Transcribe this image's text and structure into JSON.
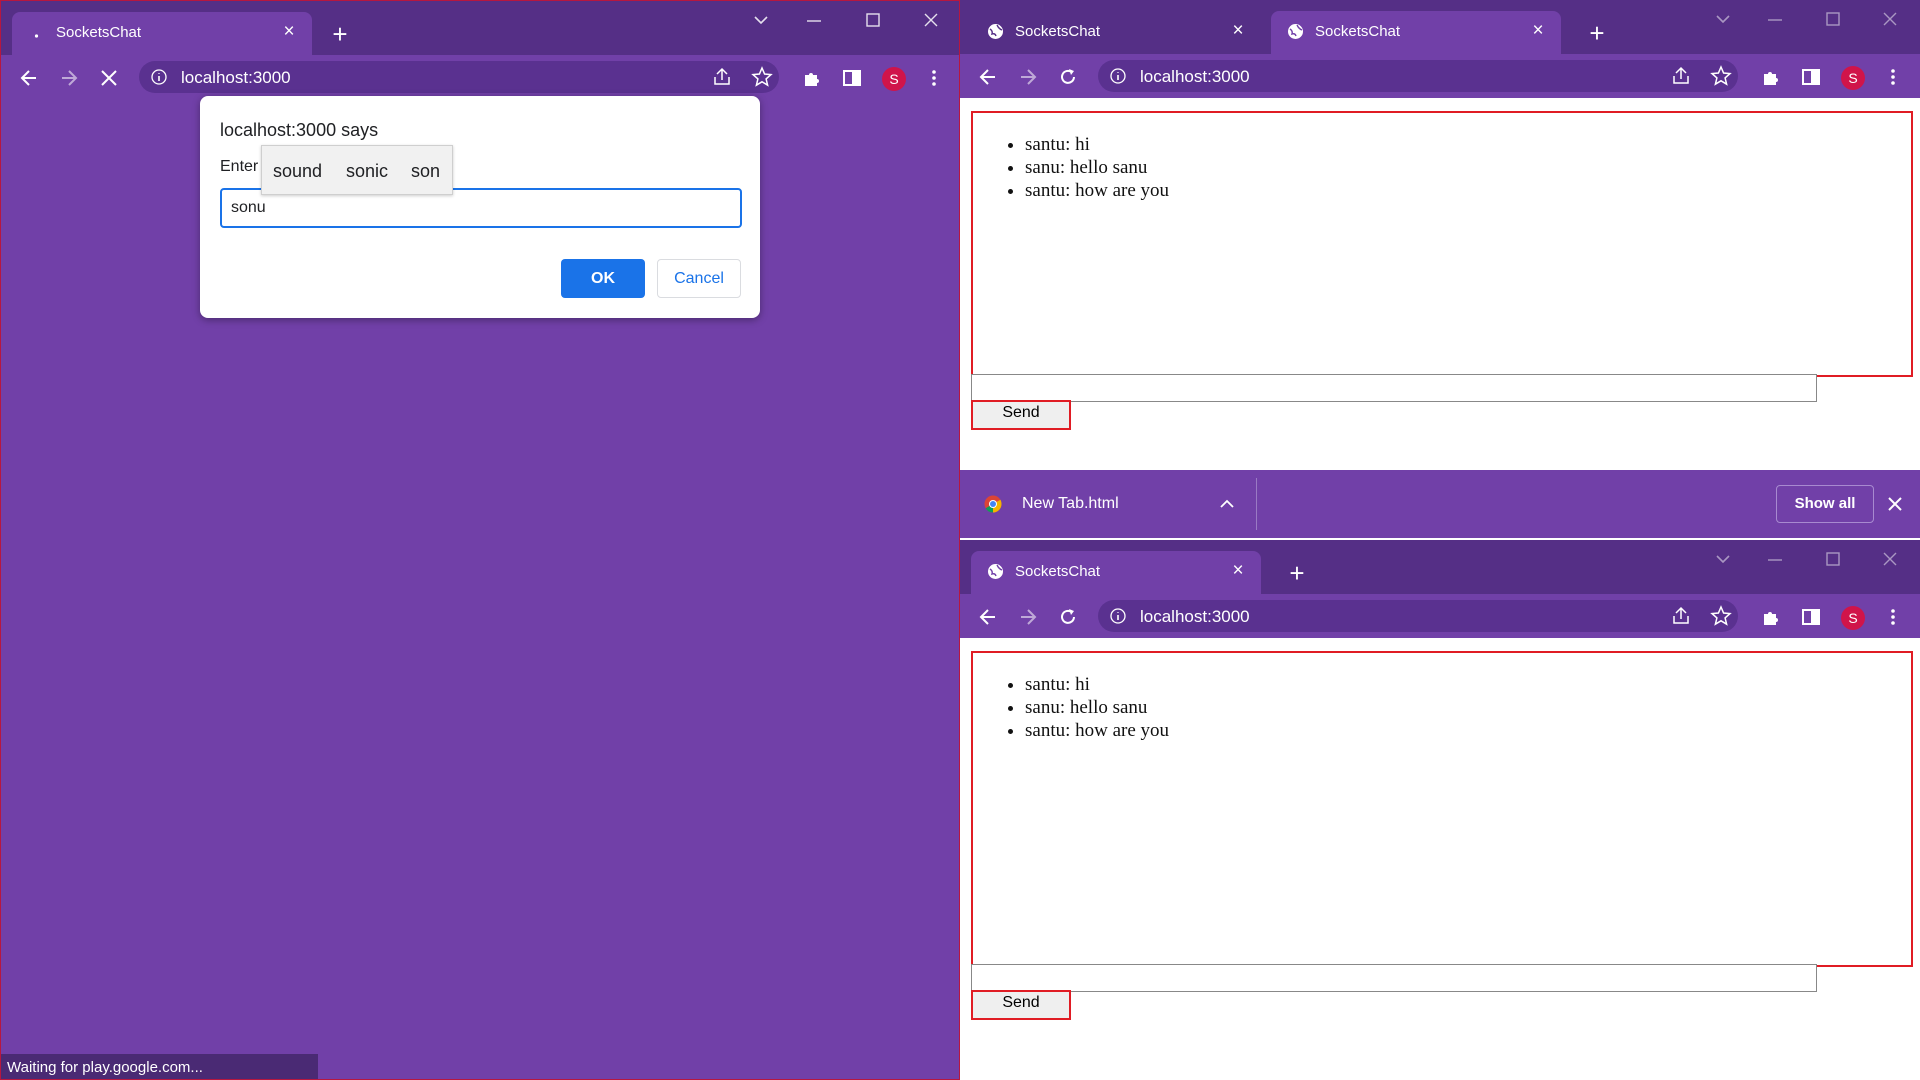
{
  "left_window": {
    "tab": {
      "title": "SocketsChat"
    },
    "address": "localhost:3000",
    "dialog": {
      "title": "localhost:3000 says",
      "prompt_label": "Enter",
      "suggestions": [
        "sound",
        "sonic",
        "son"
      ],
      "input_value": "sonu",
      "ok_label": "OK",
      "cancel_label": "Cancel"
    },
    "status_text": "Waiting for play.google.com...",
    "avatar_letter": "S"
  },
  "top_right_window": {
    "tabs": [
      {
        "title": "SocketsChat",
        "active": false
      },
      {
        "title": "SocketsChat",
        "active": true
      }
    ],
    "address": "localhost:3000",
    "avatar_letter": "S",
    "messages": [
      "santu: hi",
      "sanu: hello sanu",
      "santu: how are you"
    ],
    "send_label": "Send"
  },
  "download_bar": {
    "file_name": "New Tab.html",
    "show_all_label": "Show all"
  },
  "bottom_right_window": {
    "tab": {
      "title": "SocketsChat"
    },
    "address": "localhost:3000",
    "avatar_letter": "S",
    "messages": [
      "santu: hi",
      "sanu: hello sanu",
      "santu: how are you"
    ],
    "send_label": "Send"
  },
  "colors": {
    "frame_dark": "#552f86",
    "frame_light": "#7140a8",
    "accent_blue": "#1a73e8",
    "chat_border_red": "#e01c24"
  }
}
